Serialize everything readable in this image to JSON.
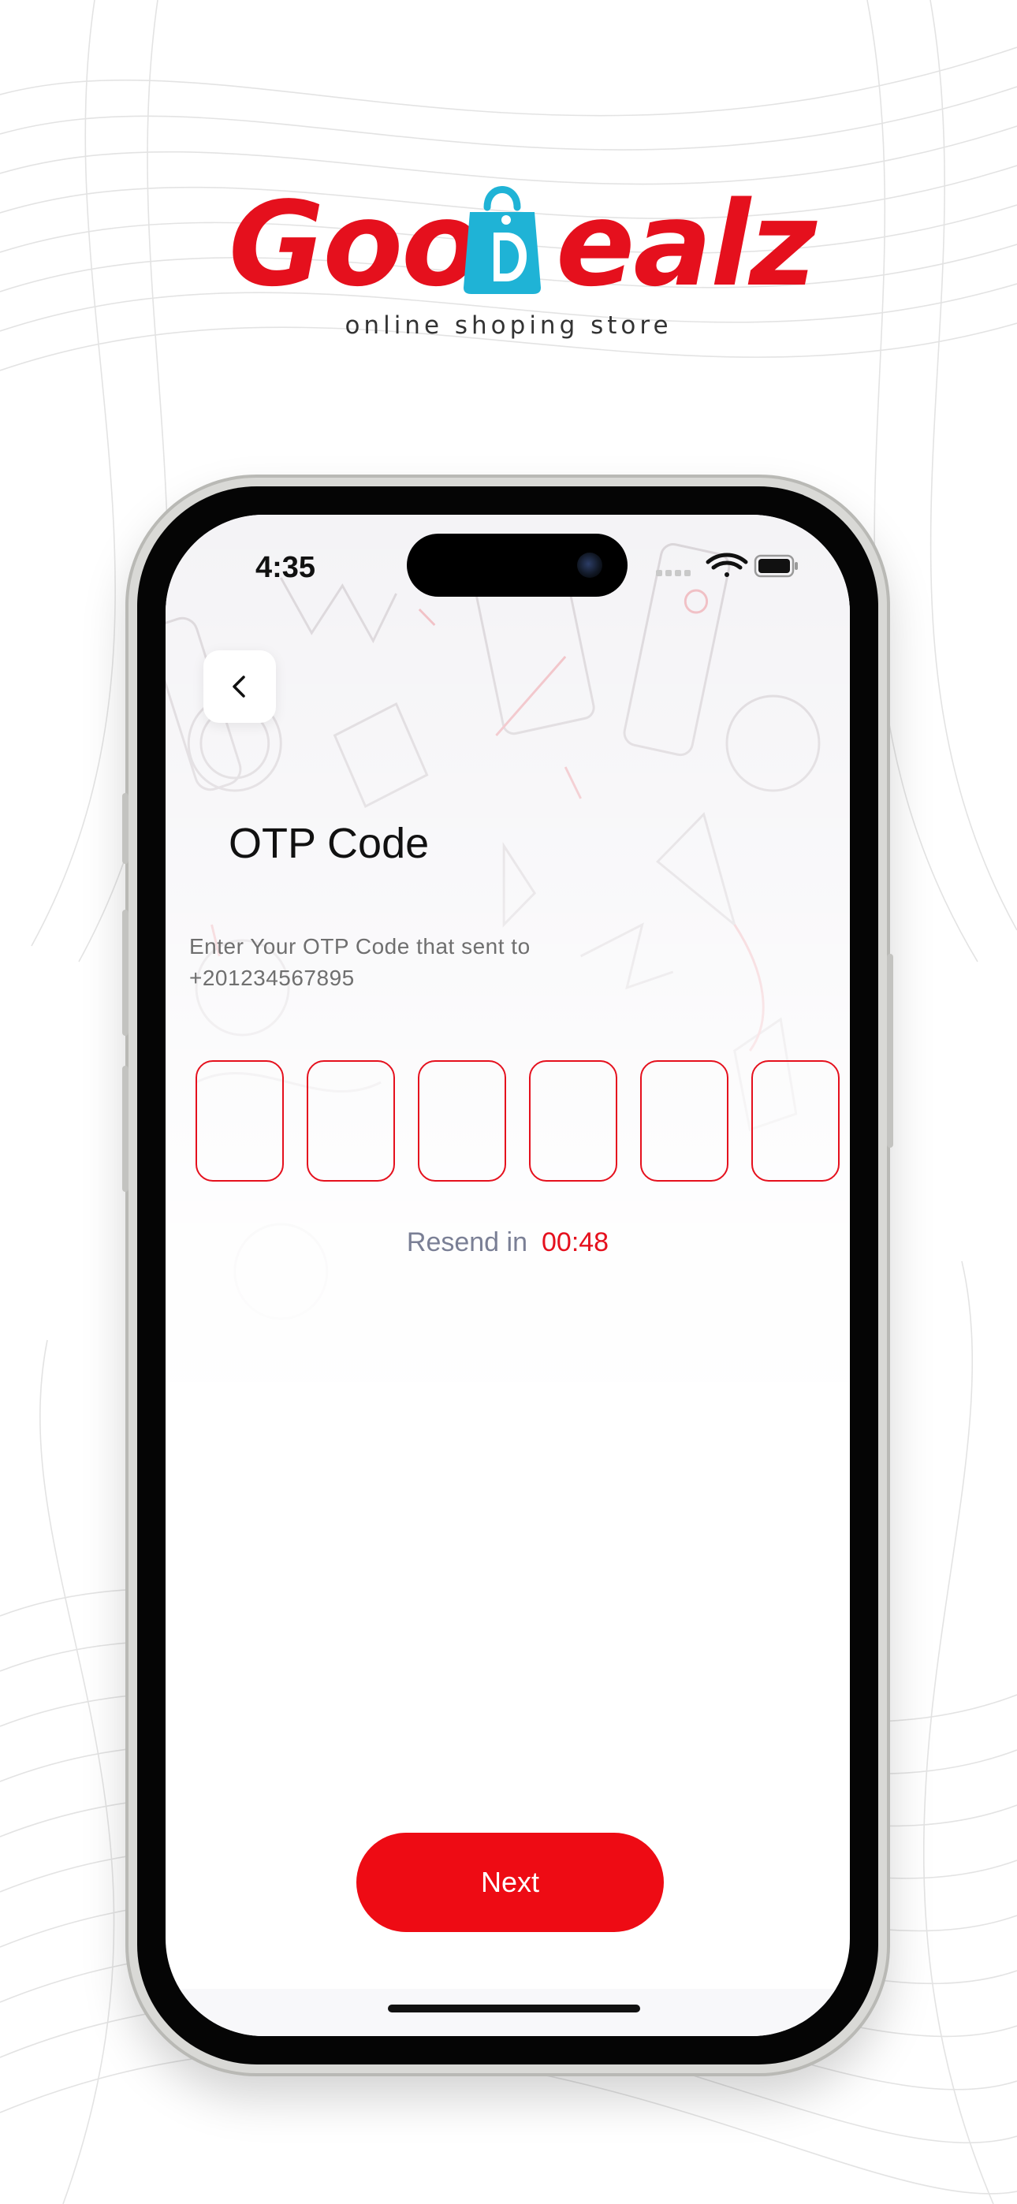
{
  "brand": {
    "logo_left": "Goo",
    "logo_right": "ealz",
    "tagline": "online shoping store",
    "colors": {
      "primary": "#e5101d",
      "bag": "#1fb3d6"
    }
  },
  "status_bar": {
    "time": "4:35",
    "icons": [
      "signal-icon",
      "wifi-icon",
      "battery-icon"
    ]
  },
  "screen": {
    "back_icon": "chevron-left-icon",
    "title": "OTP Code",
    "description_line1": "Enter Your OTP Code that sent to",
    "description_line2": "+201234567895",
    "otp_digits": [
      "",
      "",
      "",
      "",
      "",
      ""
    ],
    "resend_label": "Resend in",
    "resend_timer": "00:48",
    "next_label": "Next"
  }
}
